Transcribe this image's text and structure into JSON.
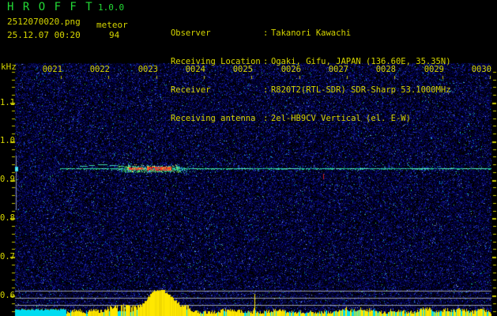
{
  "app": {
    "title": "H R O F F T",
    "version": "1.0.0",
    "filename": "2512070020.png",
    "mode": "meteor",
    "datetime": "25.12.07 00:20",
    "count": "94"
  },
  "info": {
    "sep": ":",
    "rows": [
      {
        "label": "Observer",
        "value": "Takanori Kawachi"
      },
      {
        "label": "Receiving Location",
        "value": "Ogaki, Gifu, JAPAN (136.60E, 35.35N)"
      },
      {
        "label": "Receiver",
        "value": "R820T2(RTL-SDR) SDR-Sharp 53.1000MHz"
      },
      {
        "label": "Receiving antenna",
        "value": "2el-HB9CV Vertical (el. E-W)"
      }
    ]
  },
  "chart_data": {
    "type": "heatmap",
    "subtype": "meteor-radio-spectrogram (HROFFT waterfall)",
    "title": "",
    "xlabel": "",
    "ylabel": "kHz",
    "x_tick_labels": [
      "0021",
      "0022",
      "0023",
      "0024",
      "0025",
      "0026",
      "0027",
      "0028",
      "0029",
      "0030"
    ],
    "x_range": [
      "0020",
      "0030"
    ],
    "y_tick_labels": [
      "1.1",
      "1.0",
      "0.9",
      "0.8",
      "0.7",
      "0.6"
    ],
    "ylim": [
      0.58,
      1.18
    ],
    "grid": false,
    "legend": false,
    "noise_floor": "dense dark-blue speckle with sparse cyan/green dots",
    "features": {
      "carrier_line": {
        "freq_khz": 0.93,
        "from_x_label": "0021",
        "to_x_label": "0030",
        "color": "cyan-green"
      },
      "meteor_echo": {
        "center_x_label": "0023",
        "freq_khz": 0.93,
        "bandwidth_khz": 0.04,
        "description": "bright overdense echo: red/yellow core with cyan-green scatter and drifting head-echo dashes approaching from the left"
      },
      "left_marker_line": {
        "x_label": "0020",
        "freq_span_khz": [
          0.79,
          0.94
        ],
        "color": "gray"
      },
      "signal_strength_band": {
        "reference_lines_y_khz": [
          0.612,
          0.594,
          0.576
        ],
        "peak_x_label": "0023",
        "bar_color": "yellow",
        "baseline_color": "cyan",
        "spike_x_label": "0025"
      }
    },
    "colors": {
      "text_yellow": "#d6d600",
      "title_green": "#23d935",
      "tick_yellow": "#c8c800",
      "gray_line": "#9aa0a8",
      "echo_cyan": "#2fd8a8",
      "echo_red": "#e83030",
      "bar_yellow": "#ffe800",
      "bar_cyan": "#00dcf0"
    }
  }
}
